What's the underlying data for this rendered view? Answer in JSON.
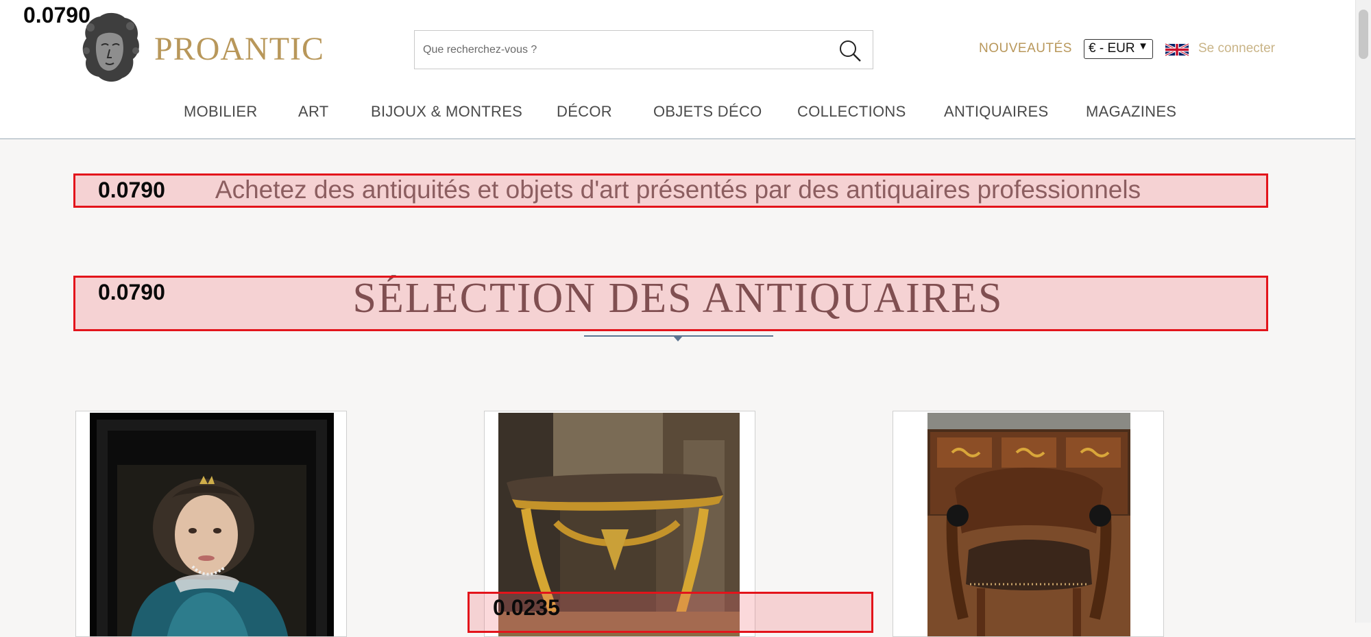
{
  "header": {
    "logo_text": "PROANTIC",
    "search": {
      "placeholder": "Que recherchez-vous ?"
    },
    "new_label": "NOUVEAUTÉS",
    "currency": "€ - EUR",
    "login_label": "Se connecter"
  },
  "nav": {
    "items": [
      "MOBILIER",
      "ART",
      "BIJOUX & MONTRES",
      "DÉCOR",
      "OBJETS DÉCO",
      "COLLECTIONS",
      "ANTIQUAIRES",
      "MAGAZINES"
    ]
  },
  "main": {
    "intro": "Achetez des antiquités et objets d'art présentés par des antiquaires professionnels",
    "section_title": "SÉLECTION DES ANTIQUAIRES"
  },
  "overlays": {
    "corner_label": "0.0790",
    "intro_label": "0.0790",
    "title_label": "0.0790",
    "card_label": "0.0235"
  },
  "products": [
    {
      "subject": "framed-portrait-painting"
    },
    {
      "subject": "gilt-console-table"
    },
    {
      "subject": "leather-armchair-and-commode"
    }
  ],
  "colors": {
    "brand_gold": "#b8975a",
    "overlay_border": "#e3141b",
    "nav_text": "#4a4a4a",
    "divider": "#5c7592"
  }
}
